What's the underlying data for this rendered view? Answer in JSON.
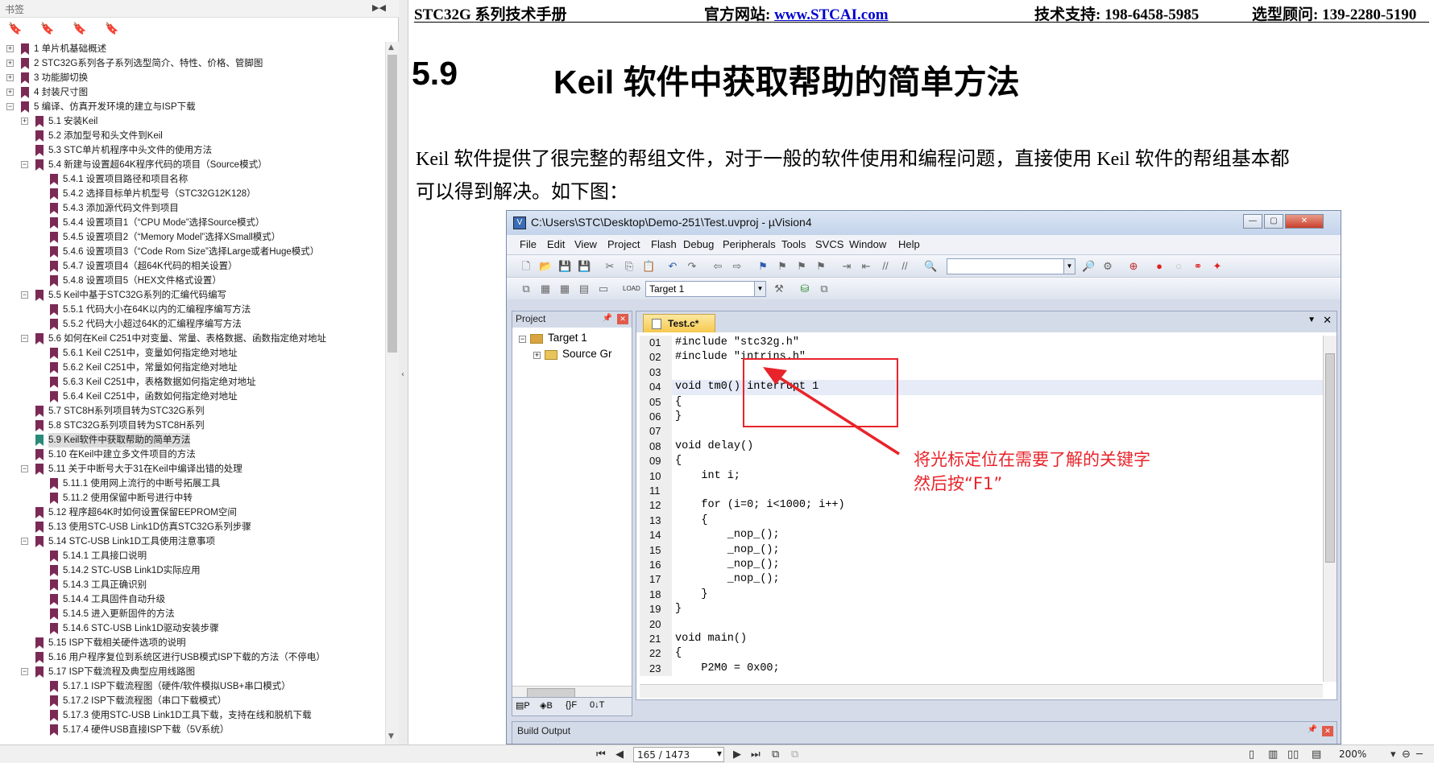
{
  "left_panel": {
    "title": "书签",
    "bookmarks": [
      {
        "text": "1 单片机基础概述",
        "level": 0,
        "exp": "+"
      },
      {
        "text": "2 STC32G系列各子系列选型简介、特性、价格、管脚图",
        "level": 0,
        "exp": "+"
      },
      {
        "text": "3 功能脚切换",
        "level": 0,
        "exp": "+"
      },
      {
        "text": "4 封装尺寸图",
        "level": 0,
        "exp": "+"
      },
      {
        "text": "5 编译、仿真开发环境的建立与ISP下载",
        "level": 0,
        "exp": "-"
      },
      {
        "text": "5.1 安装Keil",
        "level": 1,
        "exp": "+"
      },
      {
        "text": "5.2 添加型号和头文件到Keil",
        "level": 1,
        "exp": ""
      },
      {
        "text": "5.3 STC单片机程序中头文件的使用方法",
        "level": 1,
        "exp": ""
      },
      {
        "text": "5.4 新建与设置超64K程序代码的项目（Source模式）",
        "level": 1,
        "exp": "-"
      },
      {
        "text": "5.4.1 设置项目路径和项目名称",
        "level": 2,
        "exp": ""
      },
      {
        "text": "5.4.2 选择目标单片机型号（STC32G12K128）",
        "level": 2,
        "exp": ""
      },
      {
        "text": "5.4.3 添加源代码文件到项目",
        "level": 2,
        "exp": ""
      },
      {
        "text": "5.4.4 设置项目1（“CPU Mode”选择Source模式）",
        "level": 2,
        "exp": ""
      },
      {
        "text": "5.4.5 设置项目2（“Memory Model”选择XSmall模式）",
        "level": 2,
        "exp": ""
      },
      {
        "text": "5.4.6  设置项目3（“Code Rom Size”选择Large或者Huge模式）",
        "level": 2,
        "exp": ""
      },
      {
        "text": "5.4.7  设置项目4（超64K代码的相关设置）",
        "level": 2,
        "exp": ""
      },
      {
        "text": "5.4.8  设置项目5（HEX文件格式设置）",
        "level": 2,
        "exp": ""
      },
      {
        "text": "5.5 Keil中基于STC32G系列的汇编代码编写",
        "level": 1,
        "exp": "-"
      },
      {
        "text": "5.5.1 代码大小在64K以内的汇编程序编写方法",
        "level": 2,
        "exp": ""
      },
      {
        "text": "5.5.2 代码大小超过64K的汇编程序编写方法",
        "level": 2,
        "exp": ""
      },
      {
        "text": "5.6 如何在Keil C251中对变量、常量、表格数据、函数指定绝对地址",
        "level": 1,
        "exp": "-"
      },
      {
        "text": "5.6.1 Keil C251中，变量如何指定绝对地址",
        "level": 2,
        "exp": ""
      },
      {
        "text": "5.6.2  Keil C251中，常量如何指定绝对地址",
        "level": 2,
        "exp": ""
      },
      {
        "text": "5.6.3  Keil C251中，表格数据如何指定绝对地址",
        "level": 2,
        "exp": ""
      },
      {
        "text": "5.6.4  Keil C251中，函数如何指定绝对地址",
        "level": 2,
        "exp": ""
      },
      {
        "text": "5.7 STC8H系列项目转为STC32G系列",
        "level": 1,
        "exp": ""
      },
      {
        "text": "5.8 STC32G系列项目转为STC8H系列",
        "level": 1,
        "exp": ""
      },
      {
        "text": "5.9 Keil软件中获取帮助的简单方法",
        "level": 1,
        "exp": "",
        "selected": true
      },
      {
        "text": "5.10 在Keil中建立多文件项目的方法",
        "level": 1,
        "exp": ""
      },
      {
        "text": "5.11 关于中断号大于31在Keil中编译出错的处理",
        "level": 1,
        "exp": "-"
      },
      {
        "text": "5.11.1 使用网上流行的中断号拓展工具",
        "level": 2,
        "exp": ""
      },
      {
        "text": "5.11.2 使用保留中断号进行中转",
        "level": 2,
        "exp": ""
      },
      {
        "text": "5.12 程序超64K时如何设置保留EEPROM空间",
        "level": 1,
        "exp": ""
      },
      {
        "text": "5.13 使用STC-USB Link1D仿真STC32G系列步骤",
        "level": 1,
        "exp": ""
      },
      {
        "text": "5.14 STC-USB Link1D工具使用注意事项",
        "level": 1,
        "exp": "-"
      },
      {
        "text": "5.14.1 工具接口说明",
        "level": 2,
        "exp": ""
      },
      {
        "text": "5.14.2  STC-USB Link1D实际应用",
        "level": 2,
        "exp": ""
      },
      {
        "text": "5.14.3  工具正确识别",
        "level": 2,
        "exp": ""
      },
      {
        "text": "5.14.4 工具固件自动升级",
        "level": 2,
        "exp": ""
      },
      {
        "text": "5.14.5 进入更新固件的方法",
        "level": 2,
        "exp": ""
      },
      {
        "text": "5.14.6  STC-USB Link1D驱动安装步骤",
        "level": 2,
        "exp": ""
      },
      {
        "text": "5.15 ISP下载相关硬件选项的说明",
        "level": 1,
        "exp": ""
      },
      {
        "text": "5.16 用户程序复位到系统区进行USB模式ISP下载的方法（不停电）",
        "level": 1,
        "exp": ""
      },
      {
        "text": "5.17 ISP下载流程及典型应用线路图",
        "level": 1,
        "exp": "-"
      },
      {
        "text": "5.17.1 ISP下载流程图（硬件/软件模拟USB+串口模式）",
        "level": 2,
        "exp": ""
      },
      {
        "text": "5.17.2  ISP下载流程图（串口下载模式）",
        "level": 2,
        "exp": ""
      },
      {
        "text": "5.17.3  使用STC-USB Link1D工具下载，支持在线和脱机下载",
        "level": 2,
        "exp": ""
      },
      {
        "text": "5.17.4  硬件USB直接ISP下载（5V系统）",
        "level": 2,
        "exp": ""
      }
    ]
  },
  "doc": {
    "header": {
      "manual": "STC32G 系列技术手册",
      "site_label": "官方网站: ",
      "site_url": "www.STCAI.com",
      "support": "技术支持: 198-6458-5985",
      "consultant": "选型顾问: 139-2280-5190"
    },
    "section": {
      "number": "5.9",
      "title": "Keil 软件中获取帮助的简单方法"
    },
    "paragraph": [
      "Keil 软件提供了很完整的帮组文件，对于一般的软件使用和编程问题，直接使用 Keil 软件的帮组基本都",
      "可以得到解决。如下图："
    ]
  },
  "keil": {
    "title": "C:\\Users\\STC\\Desktop\\Demo-251\\Test.uvproj - µVision4",
    "menu": [
      "File",
      "Edit",
      "View",
      "Project",
      "Flash",
      "Debug",
      "Peripherals",
      "Tools",
      "SVCS",
      "Window",
      "Help"
    ],
    "target": "Target 1",
    "project_panel": "Project",
    "tree": [
      "Target 1",
      "Source Gr"
    ],
    "tab": "Test.c*",
    "build_output": "Build Output",
    "code": [
      {
        "n": "01",
        "t": "#include \"stc32g.h\""
      },
      {
        "n": "02",
        "t": "#include \"intrins.h\""
      },
      {
        "n": "03",
        "t": ""
      },
      {
        "n": "04",
        "t": "void tm0() interrupt 1",
        "hl": true
      },
      {
        "n": "05",
        "t": "{"
      },
      {
        "n": "06",
        "t": "}"
      },
      {
        "n": "07",
        "t": ""
      },
      {
        "n": "08",
        "t": "void delay()"
      },
      {
        "n": "09",
        "t": "{"
      },
      {
        "n": "10",
        "t": "    int i;"
      },
      {
        "n": "11",
        "t": ""
      },
      {
        "n": "12",
        "t": "    for (i=0; i<1000; i++)"
      },
      {
        "n": "13",
        "t": "    {"
      },
      {
        "n": "14",
        "t": "        _nop_();"
      },
      {
        "n": "15",
        "t": "        _nop_();"
      },
      {
        "n": "16",
        "t": "        _nop_();"
      },
      {
        "n": "17",
        "t": "        _nop_();"
      },
      {
        "n": "18",
        "t": "    }"
      },
      {
        "n": "19",
        "t": "}"
      },
      {
        "n": "20",
        "t": ""
      },
      {
        "n": "21",
        "t": "void main()"
      },
      {
        "n": "22",
        "t": "{"
      },
      {
        "n": "23",
        "t": "    P2M0 = 0x00;"
      }
    ]
  },
  "annotation": [
    "将光标定位在需要了解的关键字",
    "然后按“F1”"
  ],
  "nav": {
    "page": "165 / 1473",
    "zoom": "200%"
  },
  "colors": {
    "accent_red": "#e8242a",
    "bookmark": "#7b2a56",
    "link": "#0000d0"
  }
}
